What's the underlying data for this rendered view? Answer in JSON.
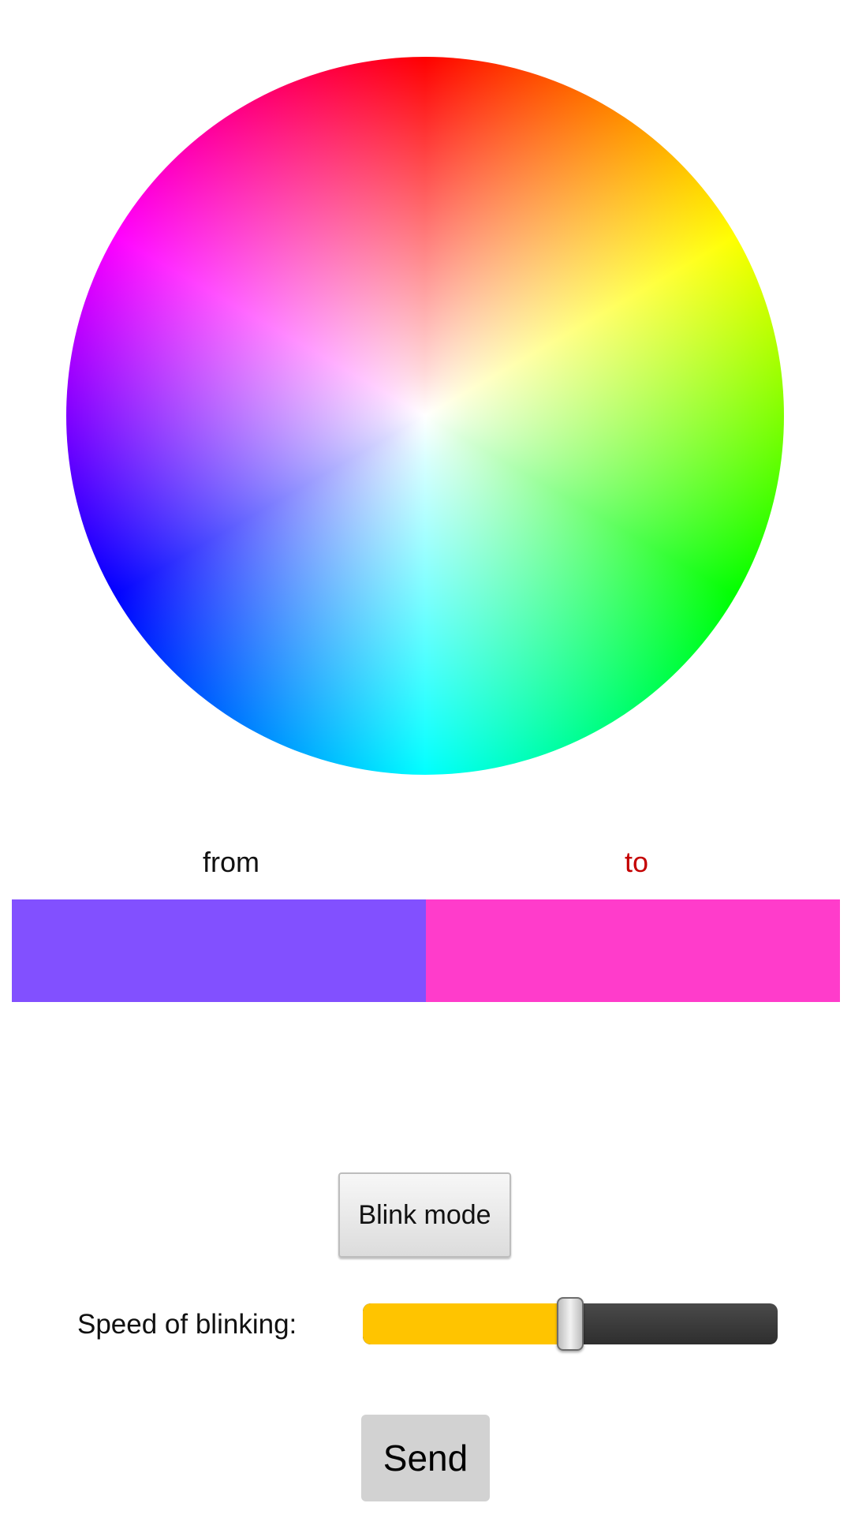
{
  "color_picker": {
    "icon": "color-wheel"
  },
  "swatches": {
    "from_label": "from",
    "to_label": "to",
    "from_color": "#8250ff",
    "to_color": "#ff3ccb",
    "active_label_color": "#c40000"
  },
  "blink": {
    "button_label": "Blink mode"
  },
  "speed": {
    "label": "Speed of blinking:",
    "value_fraction": 0.5,
    "fill_color": "#ffc400"
  },
  "actions": {
    "send_label": "Send"
  }
}
